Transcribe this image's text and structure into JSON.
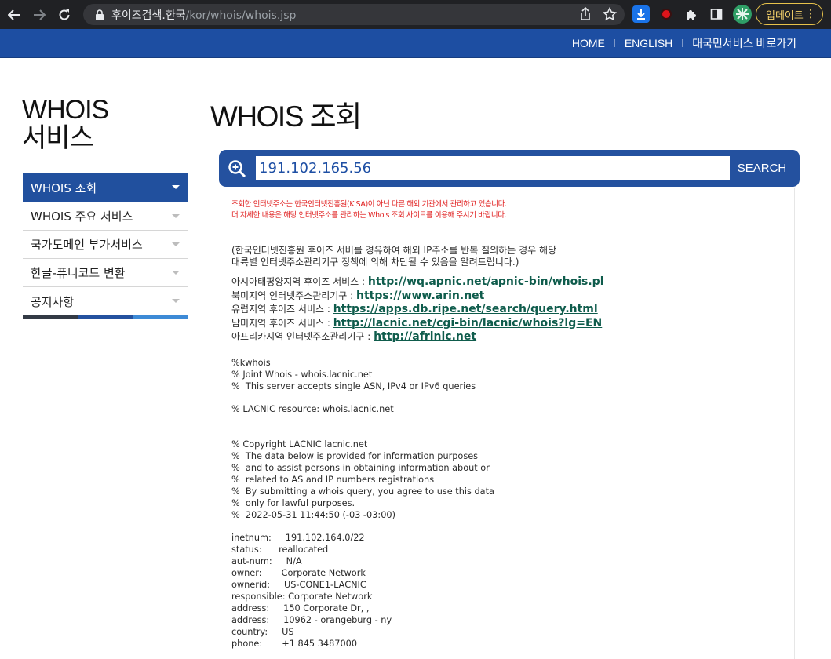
{
  "browser": {
    "url_domain": "후이즈검색.한국",
    "url_path": "/kor/whois/whois.jsp",
    "update_label": "업데이트"
  },
  "topnav": {
    "home": "HOME",
    "english": "ENGLISH",
    "shortcut": "대국민서비스 바로가기"
  },
  "sidebar": {
    "title_line1": "WHOIS",
    "title_line2": "서비스",
    "items": [
      {
        "label": "WHOIS 조회"
      },
      {
        "label": "WHOIS 주요 서비스"
      },
      {
        "label": "국가도메인 부가서비스"
      },
      {
        "label": "한글-퓨니코드 변환"
      },
      {
        "label": "공지사항"
      }
    ]
  },
  "main": {
    "title": "WHOIS 조회",
    "search": {
      "value": "191.102.165.56",
      "button": "SEARCH"
    },
    "notice": {
      "line1": "조회한 인터넷주소는 한국인터넷진흥원(KISA)이 아닌 다른 해외 기관에서 관리하고 있습니다.",
      "line2": "더 자세한 내용은 해당 인터넷주소를 관리하는 Whois 조회 사이트를 이용해 주시기 바랍니다."
    },
    "warning": {
      "line1": "(한국인터넷진흥원 후이즈 서버를 경유하여 해외 IP주소를 반복 질의하는 경우 해당",
      "line2": "대륙별 인터넷주소관리기구 정책에 의해 차단될 수 있음을 알려드립니다.)"
    },
    "registries": [
      {
        "label": "아시아태평양지역 후이즈 서비스 : ",
        "link": "http://wq.apnic.net/apnic-bin/whois.pl"
      },
      {
        "label": "북미지역 인터넷주소관리기구 : ",
        "link": "https://www.arin.net"
      },
      {
        "label": "유럽지역 후이즈 서비스 : ",
        "link": "https://apps.db.ripe.net/search/query.html"
      },
      {
        "label": "남미지역 후이즈 서비스 : ",
        "link": "http://lacnic.net/cgi-bin/lacnic/whois?lg=EN"
      },
      {
        "label": "아프리카지역 인터넷주소관리기구 : ",
        "link": "http://afrinic.net"
      }
    ],
    "raw1": "%kwhois\n% Joint Whois - whois.lacnic.net\n%  This server accepts single ASN, IPv4 or IPv6 queries",
    "raw2": "% LACNIC resource: whois.lacnic.net",
    "raw3": "% Copyright LACNIC lacnic.net\n%  The data below is provided for information purposes\n%  and to assist persons in obtaining information about or\n%  related to AS and IP numbers registrations\n%  By submitting a whois query, you agree to use this data\n%  only for lawful purposes.\n%  2022-05-31 11:44:50 (-03 -03:00)",
    "raw4": "inetnum:     191.102.164.0/22\nstatus:      reallocated\naut-num:     N/A\nowner:       Corporate Network\nownerid:     US-CONE1-LACNIC\nresponsible: Corporate Network\naddress:     150 Corporate Dr, ,\naddress:     10962 - orangeburg - ny\ncountry:     US\nphone:       +1 845 3487000"
  },
  "colors": {
    "topbar": "#1d4ea2",
    "menu_active": "#21509e",
    "notice_red": "#e02020",
    "link_green": "#0f5c4c"
  }
}
